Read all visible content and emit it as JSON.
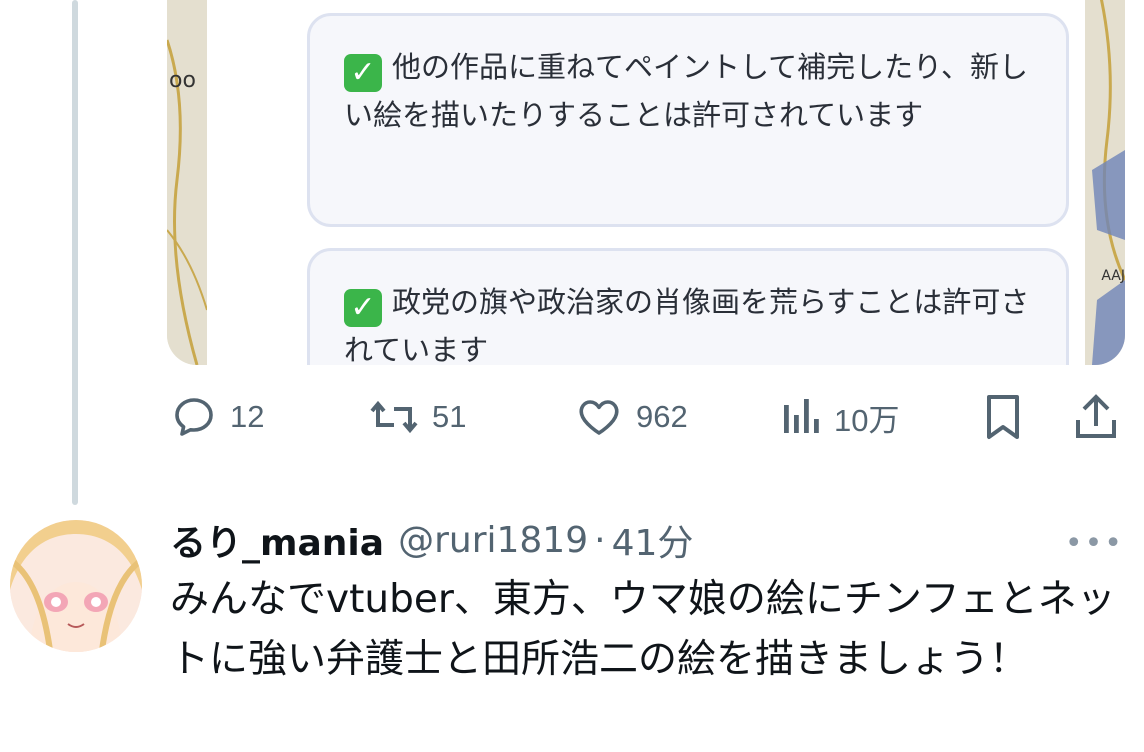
{
  "media": {
    "map_label_left": "oo",
    "map_label_right": "AAJ",
    "notices": [
      {
        "text": "他の作品に重ねてペイントして補完したり、新しい絵を描いたりすることは許可されています"
      },
      {
        "text": "政党の旗や政治家の肖像画を荒らすことは許可されています"
      }
    ],
    "check_icon": "white-check-mark-icon",
    "check_color": "#3bb54a"
  },
  "actions": {
    "reply_count": "12",
    "retweet_count": "51",
    "like_count": "962",
    "views_count": "10万"
  },
  "reply_post": {
    "display_name": "るり_mania",
    "handle": "@ruri1819",
    "separator": "·",
    "time": "41分",
    "more": "•••",
    "text": "みんなでvtuber、東方、ウマ娘の絵にチンフェとネットに強い弁護士と田所浩二の絵を描きましょう！"
  },
  "colors": {
    "muted_text": "#536471",
    "thread_line": "#cfd9de",
    "notice_bg": "#f6f7fb",
    "notice_border": "#dde2f0"
  }
}
